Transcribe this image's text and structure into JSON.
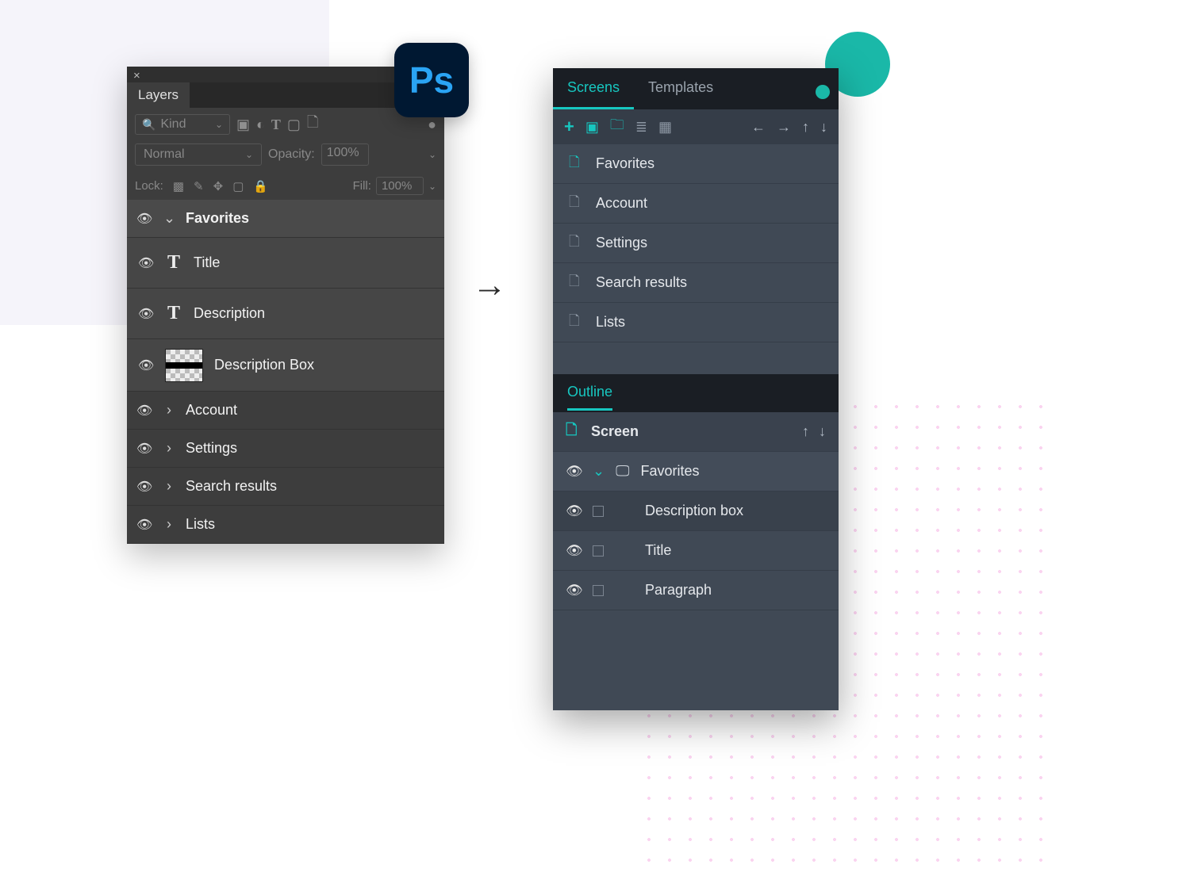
{
  "ps": {
    "logo_text": "Ps",
    "tab_label": "Layers",
    "kind_label": "Kind",
    "blend_mode": "Normal",
    "opacity_label": "Opacity:",
    "opacity_value": "100%",
    "lock_label": "Lock:",
    "fill_label": "Fill:",
    "fill_value": "100%",
    "group_open": "Favorites",
    "layers_sub": [
      "Title",
      "Description",
      "Description Box"
    ],
    "groups_closed": [
      "Account",
      "Settings",
      "Search results",
      "Lists"
    ]
  },
  "target": {
    "tabs": [
      "Screens",
      "Templates"
    ],
    "screens": [
      {
        "label": "Favorites",
        "favorite": true
      },
      {
        "label": "Account",
        "favorite": false
      },
      {
        "label": "Settings",
        "favorite": false
      },
      {
        "label": "Search results",
        "favorite": false
      },
      {
        "label": "Lists",
        "favorite": false
      }
    ],
    "outline_label": "Outline",
    "outline_root": "Screen",
    "outline_group": "Favorites",
    "outline_children": [
      "Description box",
      "Title",
      "Paragraph"
    ]
  }
}
